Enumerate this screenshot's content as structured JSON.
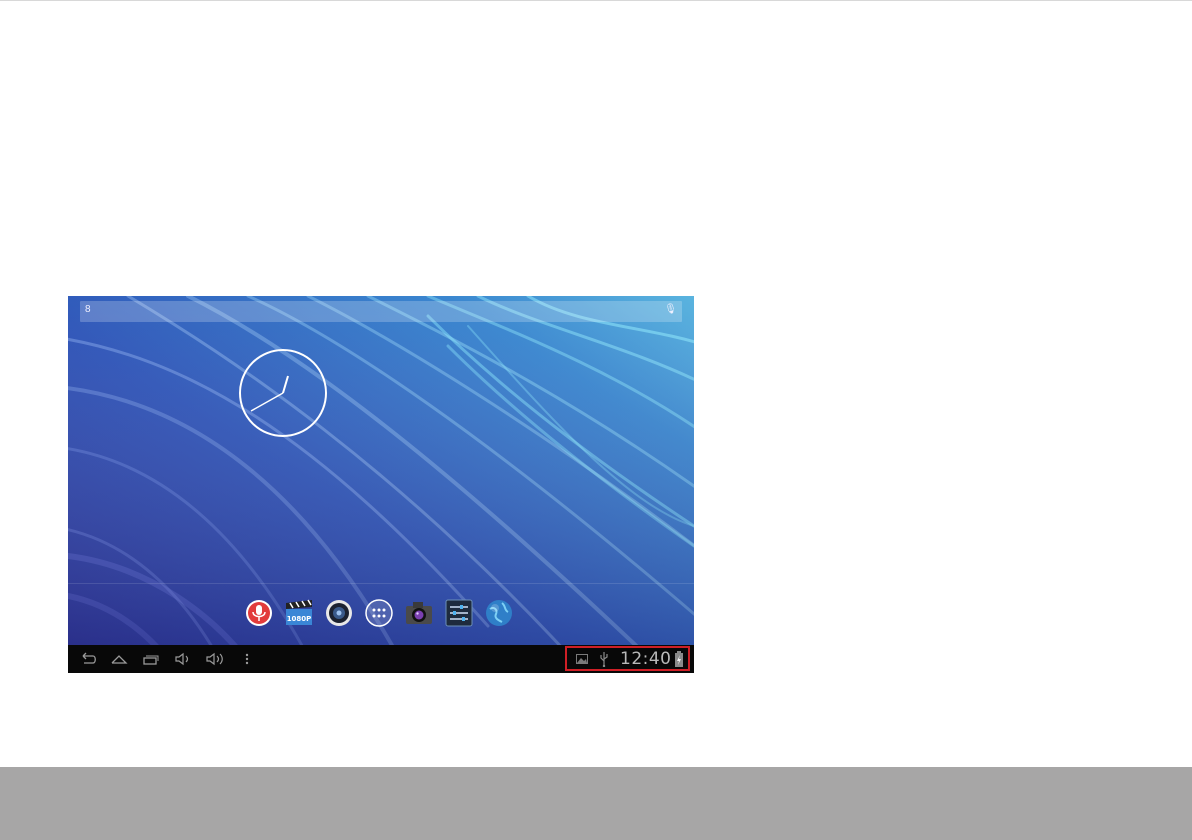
{
  "device": {
    "search_bar": {
      "google_icon": "google-g-icon",
      "voice_icon": "microphone-icon"
    },
    "clock_widget": {
      "type": "analog",
      "hour_hand": "approx 1",
      "minute_hand": "approx 40"
    },
    "dock_apps": [
      {
        "name": "voice-recorder",
        "icon": "microphone-app-icon"
      },
      {
        "name": "video",
        "icon": "clapper-app-icon",
        "badge": "1080P"
      },
      {
        "name": "music",
        "icon": "speaker-app-icon"
      },
      {
        "name": "all-apps",
        "icon": "app-drawer-icon"
      },
      {
        "name": "camera",
        "icon": "camera-app-icon"
      },
      {
        "name": "settings",
        "icon": "settings-app-icon"
      },
      {
        "name": "browser",
        "icon": "globe-app-icon"
      }
    ],
    "navbar": {
      "buttons": [
        "back-icon",
        "home-icon",
        "recent-apps-icon",
        "volume-down-icon",
        "volume-up-icon",
        "menu-icon"
      ]
    },
    "status": {
      "time": "12:40",
      "icons": [
        "image-notification-icon",
        "usb-icon",
        "battery-charging-icon"
      ]
    },
    "highlight_color": "#cf1f26"
  }
}
